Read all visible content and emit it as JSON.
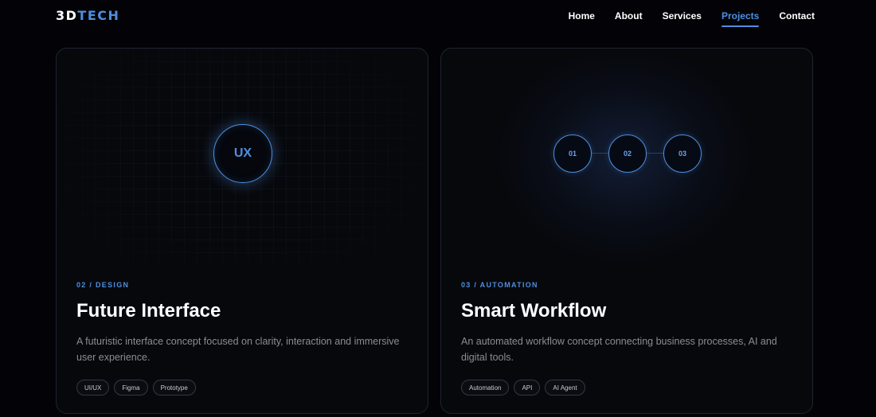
{
  "header": {
    "logo_part1": "3D",
    "logo_part2": "TECH",
    "nav": [
      {
        "label": "Home",
        "active": false
      },
      {
        "label": "About",
        "active": false
      },
      {
        "label": "Services",
        "active": false
      },
      {
        "label": "Projects",
        "active": true
      },
      {
        "label": "Contact",
        "active": false
      }
    ]
  },
  "projects": [
    {
      "visual_label": "UX",
      "category": "02 / DESIGN",
      "title": "Future Interface",
      "description": "A futuristic interface concept focused on clarity, interaction and immersive user experience.",
      "tags": [
        "UI/UX",
        "Figma",
        "Prototype"
      ]
    },
    {
      "steps": [
        "01",
        "02",
        "03"
      ],
      "category": "03 / AUTOMATION",
      "title": "Smart Workflow",
      "description": "An automated workflow concept connecting business processes, AI and digital tools.",
      "tags": [
        "Automation",
        "API",
        "AI Agent"
      ]
    }
  ],
  "colors": {
    "accent": "#4d8fe0",
    "background": "#030307",
    "card_border": "#1f2430",
    "text_muted": "#8a8d96"
  }
}
